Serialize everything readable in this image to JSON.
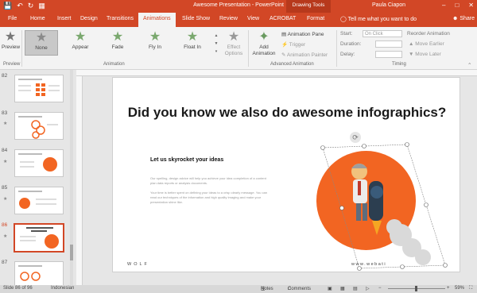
{
  "app": {
    "document_title": "Awesome Presentation - PowerPoint",
    "contextual_tab": "Drawing Tools",
    "user": "Paula Ciapon"
  },
  "tabs": [
    "File",
    "Home",
    "Insert",
    "Design",
    "Transitions",
    "Animations",
    "Slide Show",
    "Review",
    "View",
    "ACROBAT",
    "Format"
  ],
  "active_tab": "Animations",
  "tell_me_placeholder": "Tell me what you want to do",
  "share_label": "Share",
  "ribbon": {
    "preview_label": "Preview",
    "preview_group": "Preview",
    "animation_group": "Animation",
    "animations": [
      {
        "label": "None",
        "selected": true
      },
      {
        "label": "Appear",
        "selected": false
      },
      {
        "label": "Fade",
        "selected": false
      },
      {
        "label": "Fly In",
        "selected": false
      },
      {
        "label": "Float In",
        "selected": false
      }
    ],
    "effect_options_label": "Effect Options",
    "add_animation_label": "Add Animation",
    "animation_pane_label": "Animation Pane",
    "trigger_label": "Trigger",
    "animation_painter_label": "Animation Painter",
    "advanced_group": "Advanced Animation",
    "start_label": "Start:",
    "start_value": "On Click",
    "duration_label": "Duration:",
    "delay_label": "Delay:",
    "timing_group": "Timing",
    "reorder_label": "Reorder Animation",
    "move_earlier_label": "Move Earlier",
    "move_later_label": "Move Later"
  },
  "thumbnails": [
    {
      "num": "82",
      "selected": false
    },
    {
      "num": "83",
      "selected": false
    },
    {
      "num": "84",
      "selected": false
    },
    {
      "num": "85",
      "selected": false
    },
    {
      "num": "86",
      "selected": true
    },
    {
      "num": "87",
      "selected": false
    }
  ],
  "slide": {
    "title": "Did you know we also do awesome infographics?",
    "subtitle": "Let us skyrocket your ideas",
    "paragraph1": "Our spelling, design advice will help you achieve your idea completion of a content plan data reports or analysis documents.",
    "paragraph2": "Your time is better spent on defining your ideas to a crisp clearly message. You can read our techniques of the information and high quality imaging and make your presentation shine like.",
    "logo_text": "WOLF",
    "url_text": "www.webati"
  },
  "status": {
    "slide_info": "Slide 86 of 96",
    "language": "Indonesian",
    "notes_label": "Notes",
    "comments_label": "Comments",
    "zoom": "59%"
  },
  "colors": {
    "accent": "#d24726",
    "orange_circle": "#f26522"
  }
}
